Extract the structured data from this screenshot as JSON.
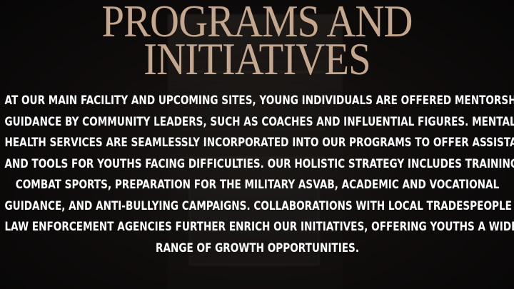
{
  "title": {
    "line1": "PROGRAMS AND",
    "line2": "INITIATIVES"
  },
  "body": {
    "lines": [
      "AT OUR MAIN FACILITY AND UPCOMING SITES, YOUNG INDIVIDUALS ARE OFFERED MENTORSHIP AND",
      "GUIDANCE BY COMMUNITY LEADERS, SUCH AS COACHES AND INFLUENTIAL FIGURES. MENTAL",
      "HEALTH SERVICES ARE SEAMLESSLY INCORPORATED INTO OUR PROGRAMS TO OFFER ASSISTANCE",
      "AND TOOLS FOR YOUTHS FACING DIFFICULTIES. OUR HOLISTIC STRATEGY INCLUDES TRAINING IN",
      "COMBAT SPORTS, PREPARATION FOR THE MILITARY ASVAB, ACADEMIC AND VOCATIONAL",
      "GUIDANCE, AND ANTI-BULLYING CAMPAIGNS. COLLABORATIONS WITH LOCAL TRADESPEOPLE AND",
      "LAW ENFORCEMENT AGENCIES FURTHER ENRICH OUR INITIATIVES, OFFERING YOUTHS A WIDE",
      "RANGE OF GROWTH OPPORTUNITIES."
    ]
  },
  "colors": {
    "background": "#0b0909",
    "title": "#c5a78e",
    "body_text": "#ffffff"
  }
}
